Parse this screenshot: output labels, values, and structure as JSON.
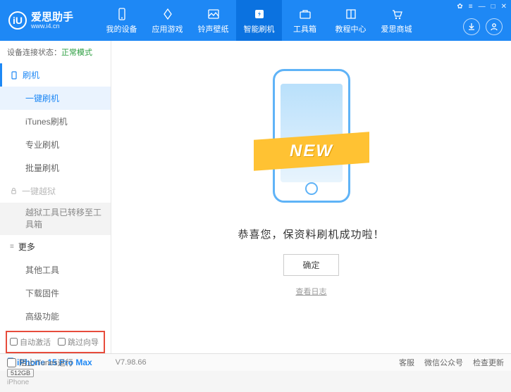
{
  "app": {
    "name": "爱思助手",
    "url": "www.i4.cn",
    "logo_letter": "iU"
  },
  "nav": [
    {
      "label": "我的设备"
    },
    {
      "label": "应用游戏"
    },
    {
      "label": "铃声壁纸"
    },
    {
      "label": "智能刷机",
      "active": true
    },
    {
      "label": "工具箱"
    },
    {
      "label": "教程中心"
    },
    {
      "label": "爱思商城"
    }
  ],
  "status": {
    "prefix": "设备连接状态：",
    "value": "正常模式"
  },
  "sidebar": {
    "cat_flash": "刷机",
    "items_flash": [
      "一键刷机",
      "iTunes刷机",
      "专业刷机",
      "批量刷机"
    ],
    "cat_jailbreak": "一键越狱",
    "jailbreak_note": "越狱工具已转移至工具箱",
    "cat_more": "更多",
    "items_more": [
      "其他工具",
      "下载固件",
      "高级功能"
    ],
    "chk_auto_activate": "自动激活",
    "chk_skip_guide": "跳过向导"
  },
  "device": {
    "name": "iPhone 15 Pro Max",
    "storage": "512GB",
    "type": "iPhone"
  },
  "main": {
    "ribbon": "NEW",
    "success": "恭喜您，保资料刷机成功啦！",
    "ok": "确定",
    "log": "查看日志"
  },
  "footer": {
    "block_itunes": "阻止iTunes运行",
    "version": "V7.98.66",
    "items": [
      "客服",
      "微信公众号",
      "检查更新"
    ]
  }
}
